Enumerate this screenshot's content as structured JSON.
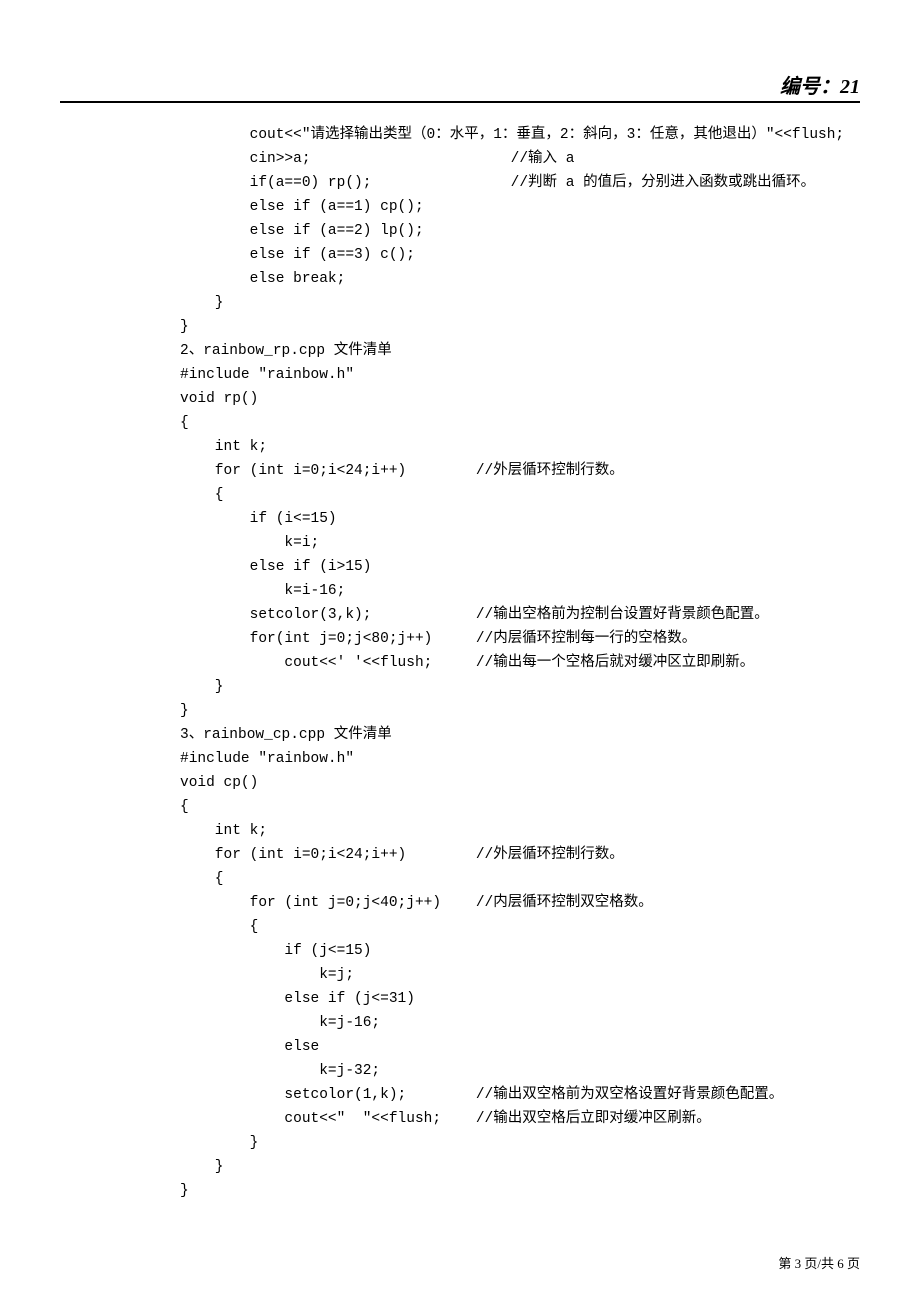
{
  "header": {
    "label": "编号：21"
  },
  "code": {
    "line01": "        cout<<\"请选择输出类型（0：水平，1：垂直，2：斜向，3：任意，其他退出）\"<<flush;",
    "line02": "        cin>>a;                       //输入 a",
    "line03": "        if(a==0) rp();                //判断 a 的值后，分别进入函数或跳出循环。",
    "line04": "        else if (a==1) cp();",
    "line05": "        else if (a==2) lp();",
    "line06": "        else if (a==3) c();",
    "line07": "        else break;",
    "line08": "    }",
    "line09": "}",
    "line10": "2、rainbow_rp.cpp 文件清单",
    "line11": "#include \"rainbow.h\"",
    "line12": "void rp()",
    "line13": "{",
    "line14": "    int k;",
    "line15": "    for (int i=0;i<24;i++)        //外层循环控制行数。",
    "line16": "    {",
    "line17": "        if (i<=15)",
    "line18": "            k=i;",
    "line19": "        else if (i>15)",
    "line20": "            k=i-16;",
    "line21": "        setcolor(3,k);            //输出空格前为控制台设置好背景颜色配置。",
    "line22": "        for(int j=0;j<80;j++)     //内层循环控制每一行的空格数。",
    "line23": "            cout<<' '<<flush;     //输出每一个空格后就对缓冲区立即刷新。",
    "line24": "    }",
    "line25": "}",
    "line26": "3、rainbow_cp.cpp 文件清单",
    "line27": "#include \"rainbow.h\"",
    "line28": "void cp()",
    "line29": "{",
    "line30": "    int k;",
    "line31": "    for (int i=0;i<24;i++)        //外层循环控制行数。",
    "line32": "    {",
    "line33": "        for (int j=0;j<40;j++)    //内层循环控制双空格数。",
    "line34": "        {",
    "line35": "            if (j<=15)",
    "line36": "                k=j;",
    "line37": "            else if (j<=31)",
    "line38": "                k=j-16;",
    "line39": "            else",
    "line40": "                k=j-32;",
    "line41": "            setcolor(1,k);        //输出双空格前为双空格设置好背景颜色配置。",
    "line42": "            cout<<\"  \"<<flush;    //输出双空格后立即对缓冲区刷新。",
    "line43": "        }",
    "line44": "    }",
    "line45": "}"
  },
  "footer": {
    "text": "第 3 页/共 6 页"
  }
}
